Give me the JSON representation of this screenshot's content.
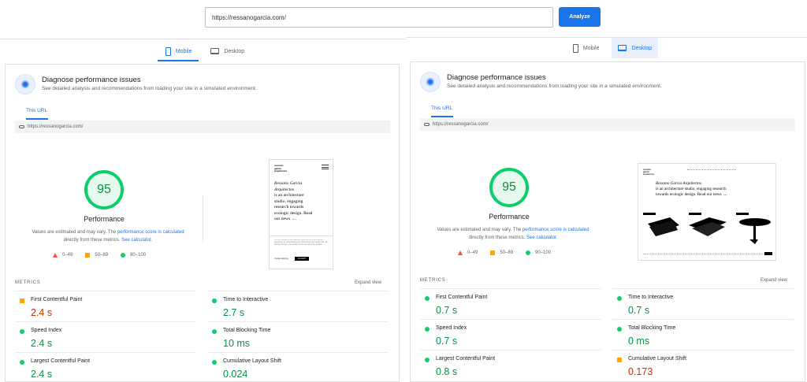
{
  "search": {
    "url": "https://ressanogarcia.com/",
    "analyze_label": "Analyze"
  },
  "left": {
    "tabs": {
      "mobile": "Mobile",
      "desktop": "Desktop",
      "active": "Mobile"
    },
    "diag_title": "Diagnose performance issues",
    "diag_sub": "See detailed analysis and recommendations from loading your site in a simulated environment.",
    "this_url": "This URL",
    "url_row": "https://ressanogarcia.com/",
    "score": "95",
    "perf_label": "Performance",
    "note_1": "Values are estimated and may vary. The ",
    "note_link1": "performance score is calculated",
    "note_2": "directly from these metrics. ",
    "note_link2": "See calculator.",
    "legend": [
      "0–49",
      "50–89",
      "90–100"
    ],
    "metrics_heading": "METRICS",
    "expand": "Expand view",
    "metrics": [
      {
        "name": "First Contentful Paint",
        "value": "2.4 s",
        "status": "avg"
      },
      {
        "name": "Time to Interactive",
        "value": "2.7 s",
        "status": "good"
      },
      {
        "name": "Speed Index",
        "value": "2.4 s",
        "status": "good"
      },
      {
        "name": "Total Blocking Time",
        "value": "10 ms",
        "status": "good"
      },
      {
        "name": "Largest Contentful Paint",
        "value": "2.4 s",
        "status": "good"
      },
      {
        "name": "Cumulative Layout Shift",
        "value": "0.024",
        "status": "good"
      }
    ],
    "thumb": {
      "logo": "ressano garcia arquitectos",
      "line1": "Ressano Garcia",
      "line2": "Arquitectos",
      "line3": "is an architecture",
      "line4": "studio, engaging",
      "line5": "research towards",
      "line6": "ecologic design. Read",
      "line7": "our news →.",
      "cookie": "We use cookies on our website to give you the most relevant experience by remembering your preferences and repeat visits. By clicking \"Accept\", you consent to the use of ALL the cookies.",
      "cookie_settings": "Cookie settings",
      "accept": "ACCEPT"
    }
  },
  "right": {
    "tabs": {
      "mobile": "Mobile",
      "desktop": "Desktop",
      "active": "Desktop"
    },
    "diag_title": "Diagnose performance issues",
    "diag_sub": "See detailed analysis and recommendations from loading your site in a simulated environment.",
    "this_url": "This URL",
    "url_row": "https://ressanogarcia.com/",
    "score": "95",
    "perf_label": "Performance",
    "note_1": "Values are estimated and may vary. The ",
    "note_link1": "performance score is calculated",
    "note_2": "directly from these metrics. ",
    "note_link2": "See calculator.",
    "legend": [
      "0–49",
      "50–89",
      "90–100"
    ],
    "metrics_heading": "METRICS",
    "expand": "Expand view",
    "metrics": [
      {
        "name": "First Contentful Paint",
        "value": "0.7 s",
        "status": "good"
      },
      {
        "name": "Time to Interactive",
        "value": "0.7 s",
        "status": "good"
      },
      {
        "name": "Speed Index",
        "value": "0.7 s",
        "status": "good"
      },
      {
        "name": "Total Blocking Time",
        "value": "0 ms",
        "status": "good"
      },
      {
        "name": "Largest Contentful Paint",
        "value": "0.8 s",
        "status": "good"
      },
      {
        "name": "Cumulative Layout Shift",
        "value": "0.173",
        "status": "avg"
      }
    ],
    "thumb": {
      "logo": "ressano garcia arquitectos",
      "line1": "Ressano Garcia Arquitectos",
      "line2": "is an architecture studio, engaging research",
      "line3": "towards ecologic design. Read our news →."
    }
  }
}
